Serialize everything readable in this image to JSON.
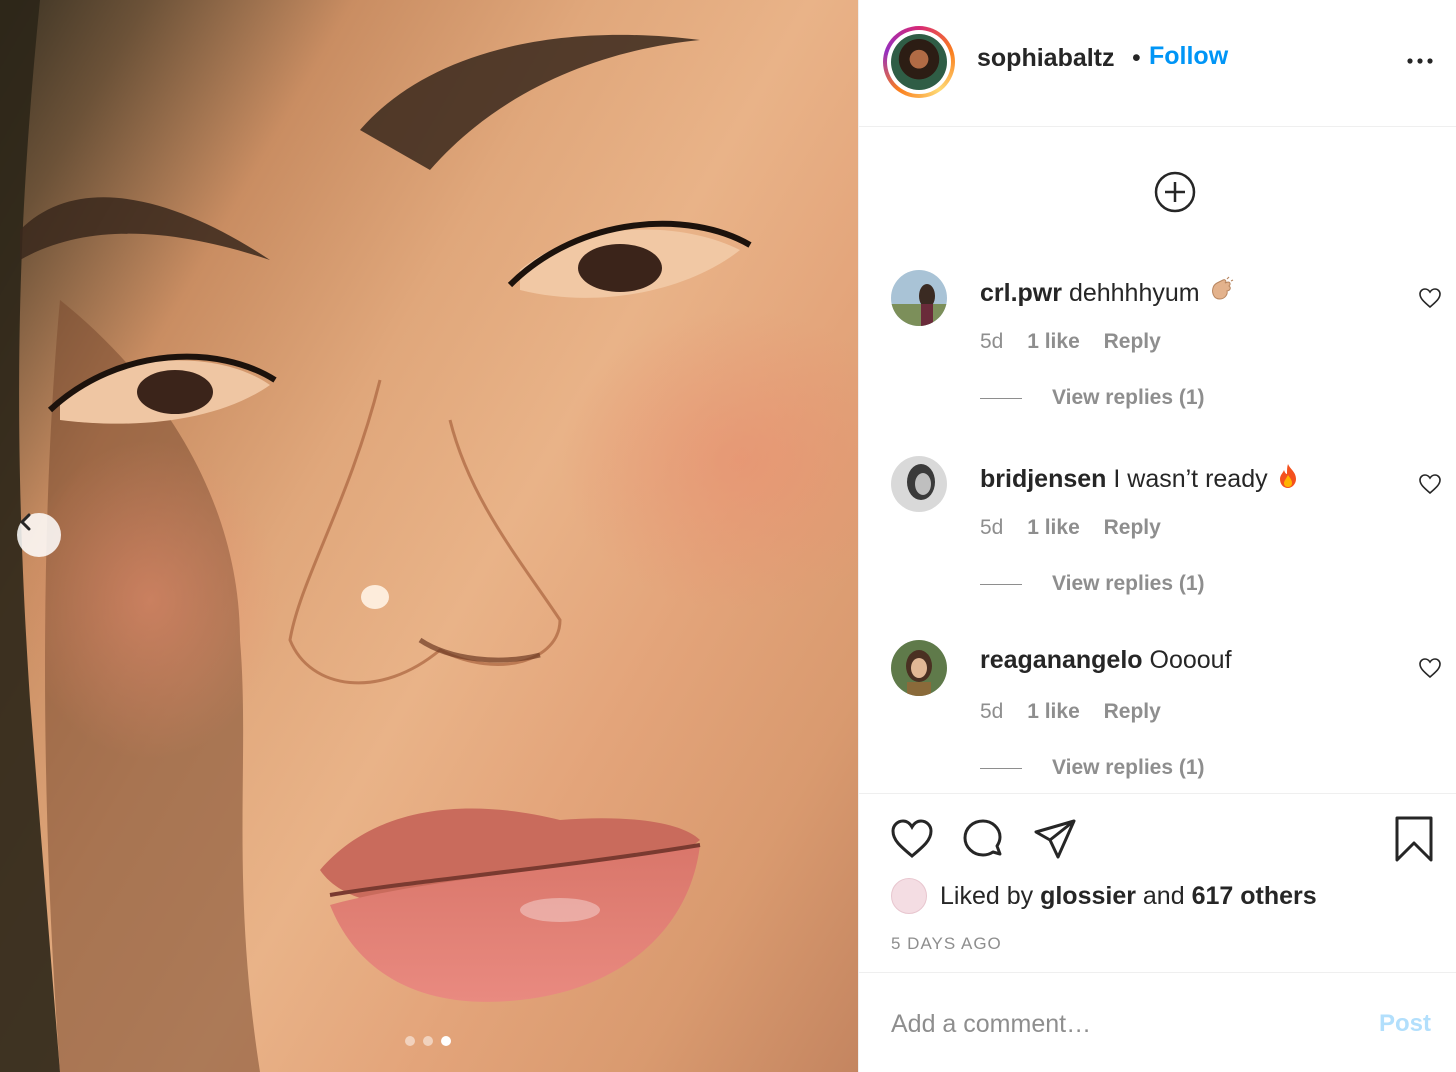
{
  "post": {
    "author": "sophiabaltz",
    "separator": "•",
    "follow_label": "Follow",
    "carousel": {
      "total": 3,
      "active": 3
    }
  },
  "comments": [
    {
      "username": "crl.pwr",
      "text": "dehhhhyum",
      "emoji": "clapping-hands",
      "time": "5d",
      "likes": "1 like",
      "reply_label": "Reply",
      "view_replies": "View replies (1)"
    },
    {
      "username": "bridjensen",
      "text": "I wasn’t ready",
      "emoji": "fire",
      "time": "5d",
      "likes": "1 like",
      "reply_label": "Reply",
      "view_replies": "View replies (1)"
    },
    {
      "username": "reaganangelo",
      "text": "Oooouf",
      "emoji": "",
      "time": "5d",
      "likes": "1 like",
      "reply_label": "Reply",
      "view_replies": "View replies (1)"
    }
  ],
  "actions": {
    "liked_prefix": "Liked by",
    "liked_user": "glossier",
    "liked_joiner": "and",
    "liked_others": "617 others",
    "timestamp": "5 DAYS AGO"
  },
  "comment_box": {
    "placeholder": "Add a comment…",
    "post_label": "Post"
  },
  "colors": {
    "link_blue": "#0095f6",
    "post_disabled": "#b2dffc",
    "muted": "#8e8e8e",
    "text": "#262626"
  }
}
